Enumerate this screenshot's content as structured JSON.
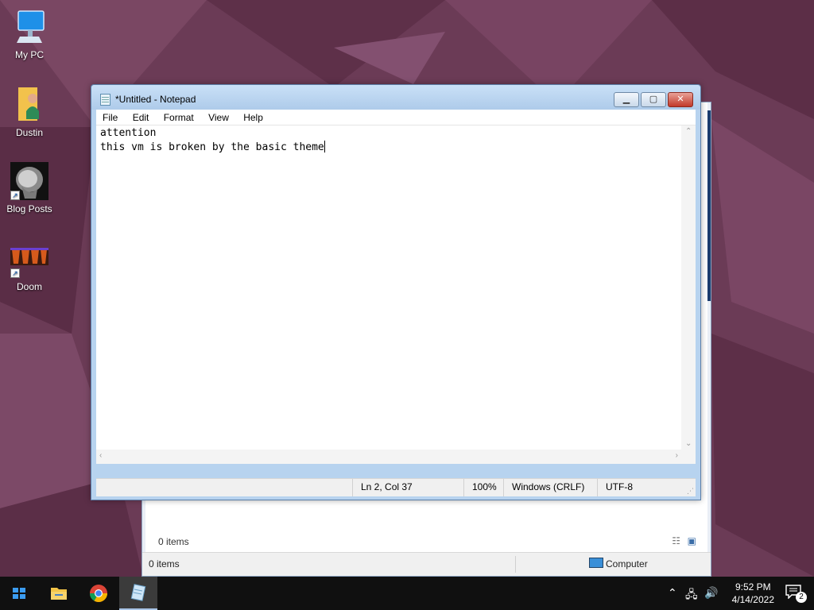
{
  "desktop": {
    "icons": [
      {
        "label": "My PC",
        "icon": "computer-icon"
      },
      {
        "label": "Dustin",
        "icon": "user-folder-icon"
      },
      {
        "label": "Blog Posts",
        "icon": "brain-scan-shortcut-icon"
      },
      {
        "label": "Doom",
        "icon": "doom-shortcut-icon"
      }
    ]
  },
  "explorer": {
    "inner_status": "0 items",
    "status_items": "0 items",
    "status_location": "Computer"
  },
  "notepad": {
    "title": "*Untitled - Notepad",
    "menu": [
      "File",
      "Edit",
      "Format",
      "View",
      "Help"
    ],
    "lines": [
      "attention",
      "this vm is broken by the basic theme"
    ],
    "status": {
      "position": "Ln 2, Col 37",
      "zoom": "100%",
      "line_ending": "Windows (CRLF)",
      "encoding": "UTF-8"
    },
    "buttons": {
      "minimize": "minimize",
      "maximize": "maximize",
      "close": "close"
    }
  },
  "taskbar": {
    "items": [
      "start-button",
      "file-explorer",
      "chrome",
      "notepad"
    ],
    "time": "9:52 PM",
    "date": "4/14/2022",
    "notification_count": "2"
  },
  "colors": {
    "wallpaper": "#6a3a55",
    "taskbar": "#101010",
    "close_button": "#c2392a"
  }
}
